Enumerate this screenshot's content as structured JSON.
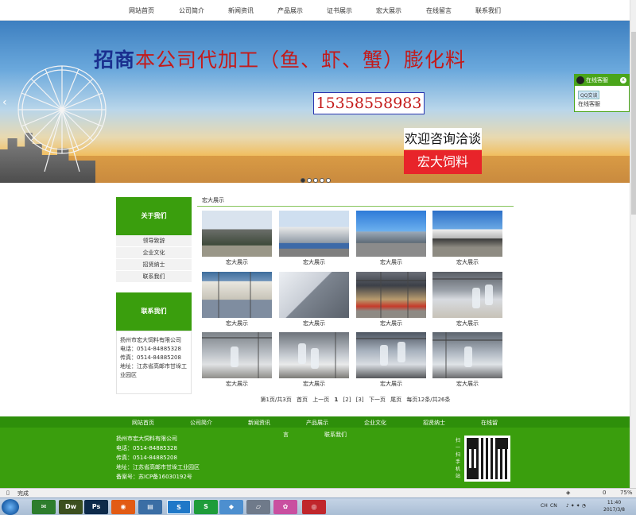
{
  "nav": [
    "网站首页",
    "公司简介",
    "新闻资讯",
    "产品展示",
    "证书展示",
    "宏大展示",
    "在线留言",
    "联系我们"
  ],
  "banner": {
    "headline_accent": "招商",
    "headline_rest": "本公司代加工（鱼、虾、蟹）膨化料",
    "phone": "15358558983",
    "box_top": "欢迎咨询洽谈",
    "box_bottom": "宏大饲料",
    "prev_arrow": "‹"
  },
  "qq": {
    "title": "在线客服",
    "button": "QQ交谈",
    "sub": "在线客服",
    "close": "x"
  },
  "sidebar": {
    "about_title": "关于我们",
    "about_items": [
      "领导致辞",
      "企业文化",
      "招贤纳士",
      "联系我们"
    ],
    "contact_title": "联系我们",
    "contact_lines": [
      "扬州市宏大饲料有限公司",
      "电话：0514-84885328",
      "传真：0514-84885208",
      "地址：江苏省高邮市甘垛工",
      "业园区"
    ]
  },
  "main": {
    "section_title": "宏大展示",
    "items": [
      "宏大展示",
      "宏大展示",
      "宏大展示",
      "宏大展示",
      "宏大展示",
      "宏大展示",
      "宏大展示",
      "宏大展示",
      "宏大展示",
      "宏大展示",
      "宏大展示",
      "宏大展示"
    ]
  },
  "pager": {
    "info": "第1页/共3页",
    "first": "首页",
    "prev": "上一页",
    "current": "1",
    "p2": "[2]",
    "p3": "[3]",
    "next": "下一页",
    "last": "尾页",
    "summary": "每页12条/共26条"
  },
  "footer": {
    "nav": [
      "网站首页",
      "公司简介",
      "新闻资讯",
      "产品展示",
      "企业文化",
      "招贤纳士",
      "在线留"
    ],
    "nav_wrap": "言",
    "nav_second": "联系我们",
    "lines": [
      "扬州市宏大饲料有限公司",
      "电话：0514-84885328",
      "传真：0514-84885208",
      "地址：江苏省高邮市甘垛工业园区",
      "备案号：苏ICP备16030192号"
    ],
    "qr_caption": "扫一扫手机站"
  },
  "status": {
    "text": "完成",
    "zone": "0",
    "zoom": "75%"
  },
  "taskbar": {
    "time": "11:40",
    "date": "2017/3/8",
    "lang1": "CH",
    "lang2": "CN"
  }
}
